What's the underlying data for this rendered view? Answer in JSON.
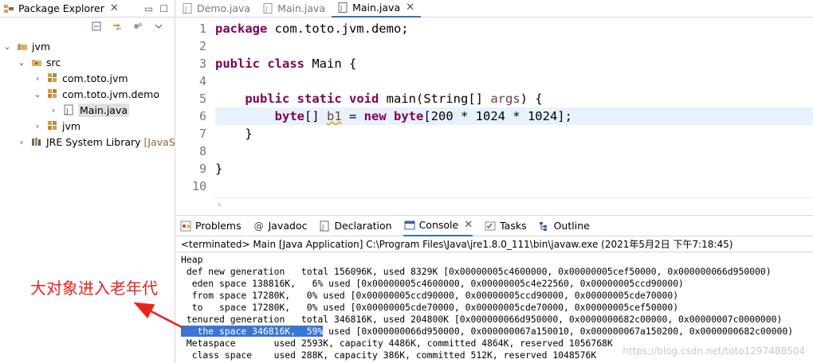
{
  "package_explorer": {
    "title": "Package Explorer",
    "tree": [
      {
        "label": "jvm",
        "suffix": "",
        "icon": "project-icon",
        "expanded": true
      },
      {
        "label": "src",
        "suffix": "",
        "icon": "source-folder-icon",
        "expanded": true
      },
      {
        "label": "com.toto.jvm",
        "suffix": "",
        "icon": "package-icon",
        "expanded": false
      },
      {
        "label": "com.toto.jvm.demo",
        "suffix": "",
        "icon": "package-icon",
        "expanded": true
      },
      {
        "label": "Main.java",
        "suffix": "",
        "icon": "java-file-icon",
        "expanded": false
      },
      {
        "label": "jvm",
        "suffix": "",
        "icon": "package-icon",
        "expanded": false
      },
      {
        "label": "JRE System Library",
        "suffix": "[JavaSE",
        "icon": "library-icon",
        "expanded": false
      }
    ]
  },
  "editor": {
    "tabs": [
      {
        "label": "Demo.java",
        "active": false
      },
      {
        "label": "Main.java",
        "active": false
      },
      {
        "label": "Main.java",
        "active": true
      }
    ],
    "line_numbers": [
      "1",
      "2",
      "3",
      "4",
      "5",
      "6",
      "7",
      "8",
      "9",
      "10"
    ],
    "current_line": 6
  },
  "console": {
    "tabs": [
      {
        "label": "Problems",
        "icon": "problems-icon",
        "active": false
      },
      {
        "label": "Javadoc",
        "icon": "javadoc-icon",
        "active": false
      },
      {
        "label": "Declaration",
        "icon": "declaration-icon",
        "active": false
      },
      {
        "label": "Console",
        "icon": "console-icon",
        "active": true
      },
      {
        "label": "Tasks",
        "icon": "tasks-icon",
        "active": false
      },
      {
        "label": "Outline",
        "icon": "outline-icon",
        "active": false
      }
    ],
    "terminated_line": "<terminated> Main [Java Application] C:\\Program Files\\Java\\jre1.8.0_111\\bin\\javaw.exe (2021年5月2日 下午7:18:45)",
    "lines": [
      "Heap",
      " def new generation   total 156096K, used 8329K [0x00000005c4600000, 0x00000005cef50000, 0x000000066d950000)",
      "  eden space 138816K,   6% used [0x00000005c4600000, 0x00000005c4e22560, 0x00000005ccd90000)",
      "  from space 17280K,   0% used [0x00000005ccd90000, 0x00000005ccd90000, 0x00000005cde70000)",
      "  to   space 17280K,   0% used [0x00000005cde70000, 0x00000005cde70000, 0x00000005cef50000)",
      " tenured generation   total 346816K, used 204800K [0x000000066d950000, 0x0000000682c00000, 0x00000007c0000000)"
    ],
    "highlight_line": {
      "selected": "   the space 346816K,  59%",
      "rest": " used [0x000000066d950000, 0x000000067a150010, 0x000000067a150200, 0x0000000682c00000)"
    },
    "lines_after": [
      " Metaspace       used 2593K, capacity 4486K, committed 4864K, reserved 1056768K",
      "  class space    used 288K, capacity 386K, committed 512K, reserved 1048576K"
    ],
    "watermark": "https://blog.csdn.net/toto1297488504"
  },
  "annotation": {
    "text": "大对象进入老年代",
    "color": "#e8231a"
  },
  "colors": {
    "keyword": "#7f0055",
    "selection": "#3875d7",
    "current_line": "#e8f2fe"
  }
}
